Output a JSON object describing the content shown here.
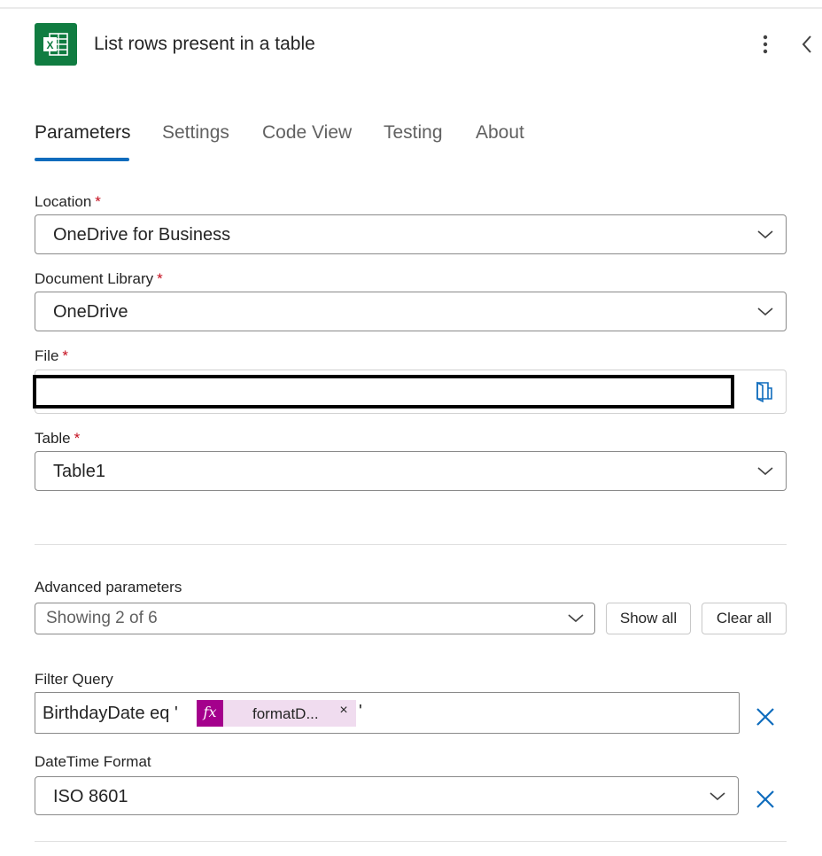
{
  "header": {
    "title": "List rows present in a table",
    "app_icon": "excel-icon",
    "more_icon": "more-vertical-icon",
    "collapse_icon": "chevron-left-icon"
  },
  "tabs": [
    {
      "label": "Parameters",
      "active": true
    },
    {
      "label": "Settings",
      "active": false
    },
    {
      "label": "Code View",
      "active": false
    },
    {
      "label": "Testing",
      "active": false
    },
    {
      "label": "About",
      "active": false
    }
  ],
  "fields": {
    "location": {
      "label": "Location",
      "required_mark": "*",
      "value": "OneDrive for Business"
    },
    "document_library": {
      "label": "Document Library",
      "required_mark": "*",
      "value": "OneDrive"
    },
    "file": {
      "label": "File",
      "required_mark": "*",
      "value": ""
    },
    "table": {
      "label": "Table",
      "required_mark": "*",
      "value": "Table1"
    }
  },
  "advanced": {
    "label": "Advanced parameters",
    "selected": "Showing 2 of 6",
    "show_all_label": "Show all",
    "clear_all_label": "Clear all"
  },
  "filter_query": {
    "label": "Filter Query",
    "prefix": "BirthdayDate eq '",
    "token_icon": "fx",
    "token_label": "formatD...",
    "token_remove": "×",
    "suffix": "'"
  },
  "datetime_format": {
    "label": "DateTime Format",
    "value": "ISO 8601"
  },
  "colors": {
    "accent": "#0f6cbd",
    "excel_green": "#107c41",
    "required_red": "#c50f1f",
    "function_token": "#a4008c",
    "function_token_bg": "#f0dcef"
  }
}
